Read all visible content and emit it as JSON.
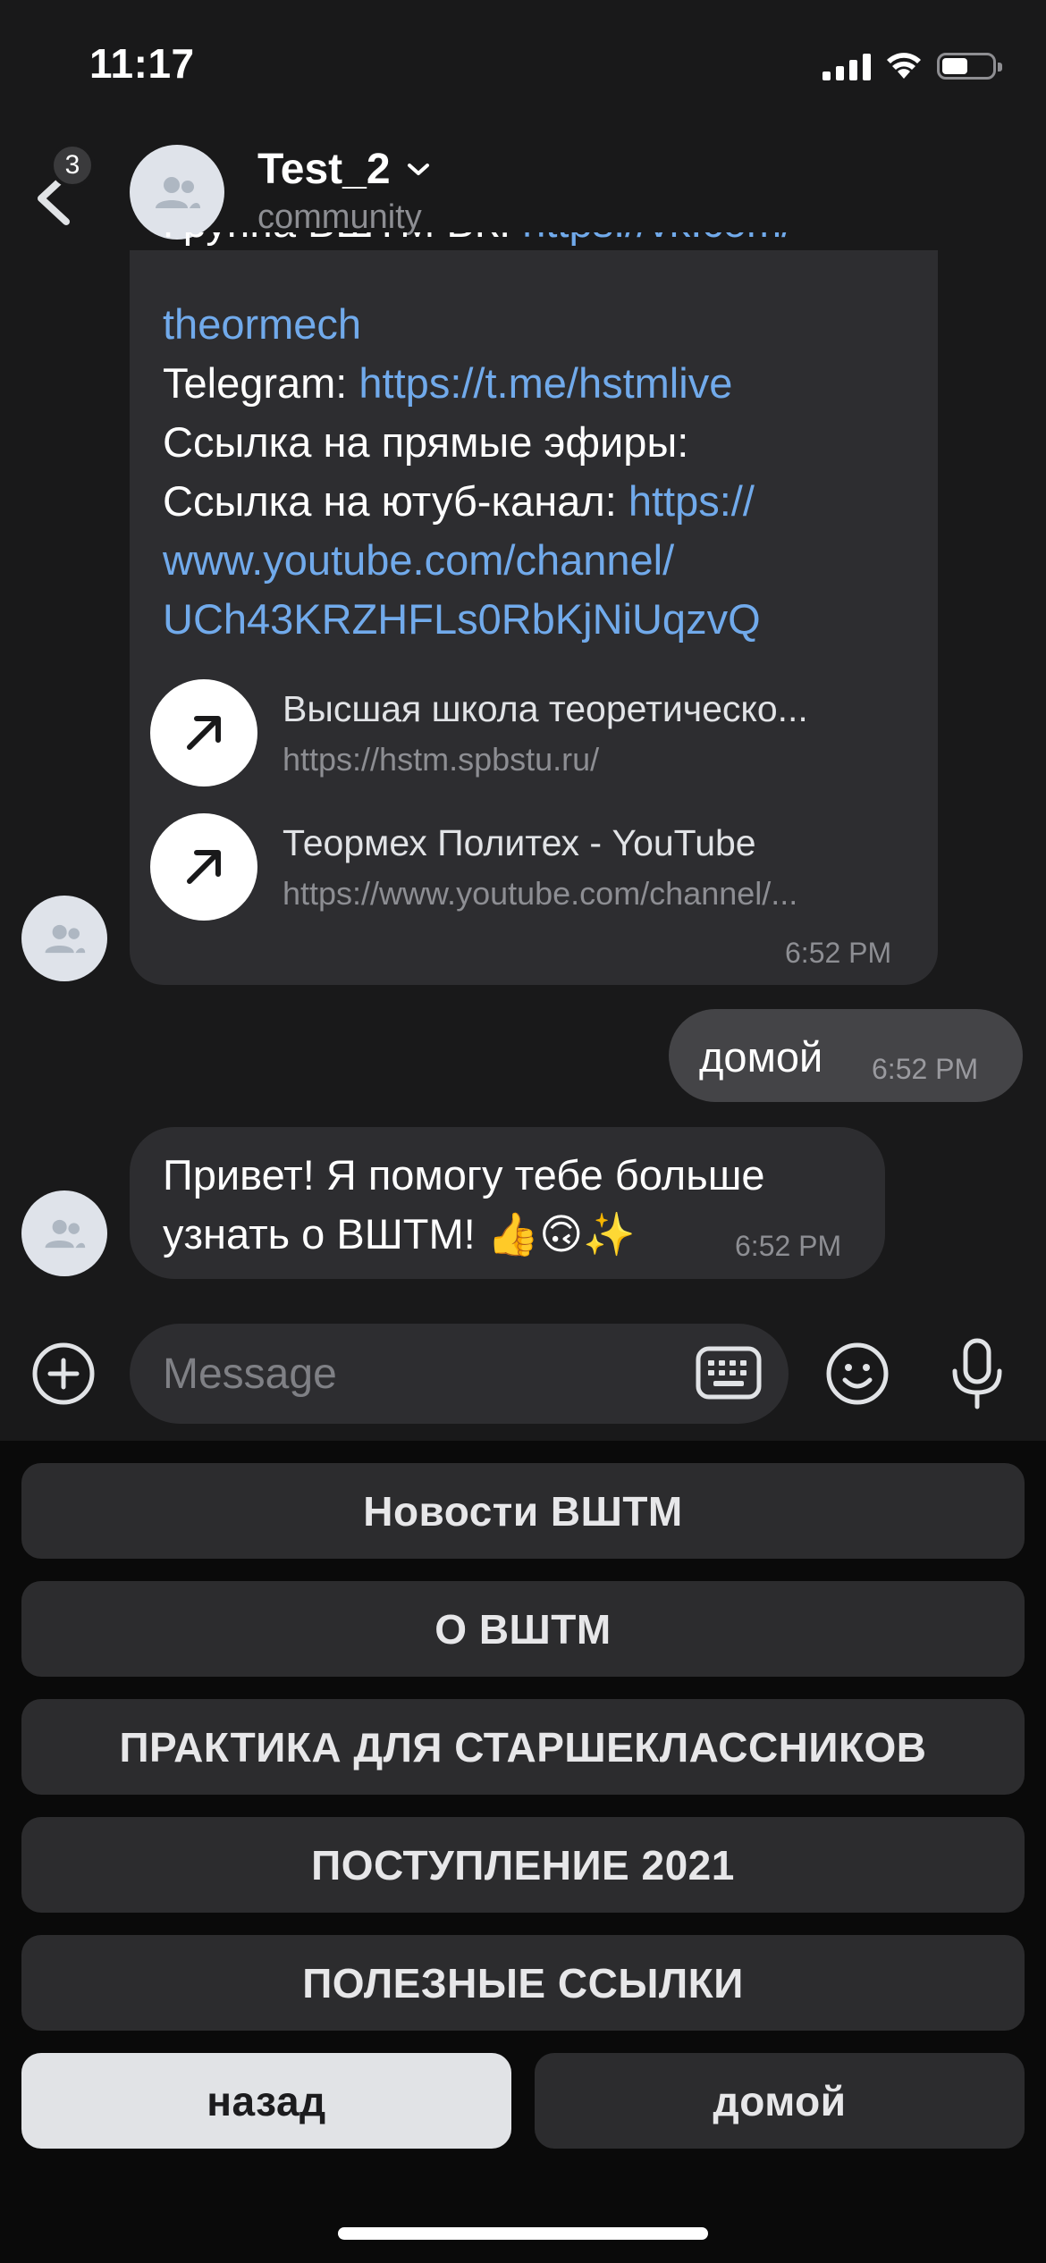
{
  "status_bar": {
    "time": "11:17"
  },
  "header": {
    "back_badge": "3",
    "title": "Test_2",
    "subtitle": "community"
  },
  "messages": {
    "bot_long": {
      "line_vk_label": "Группа ВШТМ ВК: ",
      "line_vk_link": "https://vk.com/",
      "line_vk_link2": "theormech",
      "telegram_label": "Telegram: ",
      "telegram_link": "https://t.me/hstmlive",
      "live_label": "Ссылка на прямые эфиры:",
      "youtube_label": "Ссылка на ютуб-канал: ",
      "youtube_link1": "https://",
      "youtube_link2": "www.youtube.com/channel/",
      "youtube_link3": "UCh43KRZHFLs0RbKjNiUqzvQ",
      "attachments": [
        {
          "title": "Высшая школа теоретическо...",
          "url": "https://hstm.spbstu.ru/"
        },
        {
          "title": "Теормех Политех - YouTube",
          "url": "https://www.youtube.com/channel/..."
        }
      ],
      "time": "6:52 PM"
    },
    "user_out": {
      "text": "домой",
      "time": "6:52 PM"
    },
    "bot_greeting": {
      "line1": "Привет! Я помогу тебе больше",
      "line2": "узнать о ВШТМ! 👍🙃✨",
      "time": "6:52 PM"
    }
  },
  "composer": {
    "placeholder": "Message"
  },
  "keyboard": {
    "buttons": [
      "Новости ВШТМ",
      "О ВШТМ",
      "ПРАКТИКА ДЛЯ СТАРШЕКЛАССНИКОВ",
      "ПОСТУПЛЕНИЕ 2021",
      "ПОЛЕЗНЫЕ ССЫЛКИ"
    ],
    "back": "назад",
    "home": "домой"
  },
  "colors": {
    "background": "#19191a",
    "bubble": "#2d2d30",
    "link": "#71aaeb",
    "keyboard_button": "#2c2c2e"
  }
}
